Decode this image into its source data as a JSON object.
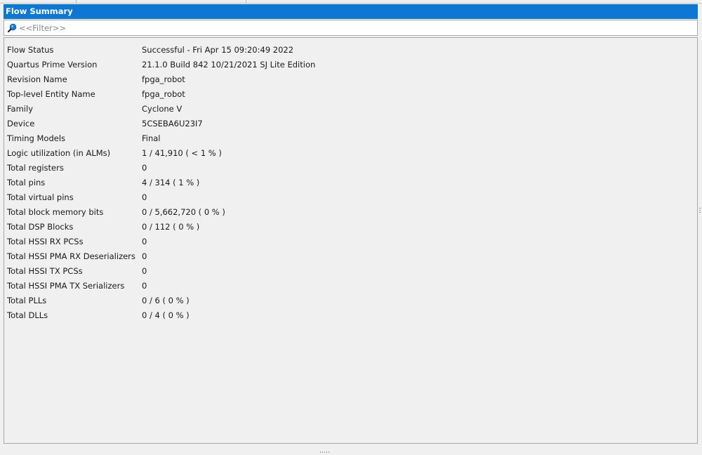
{
  "panel": {
    "title": "Flow Summary",
    "filter": {
      "placeholder": "<<Filter>>",
      "value": "",
      "icon": "search-icon"
    }
  },
  "summary": [
    {
      "label": "Flow Status",
      "value": "Successful - Fri Apr 15 09:20:49 2022"
    },
    {
      "label": "Quartus Prime Version",
      "value": "21.1.0 Build 842 10/21/2021 SJ Lite Edition"
    },
    {
      "label": "Revision Name",
      "value": "fpga_robot"
    },
    {
      "label": "Top-level Entity Name",
      "value": "fpga_robot"
    },
    {
      "label": "Family",
      "value": "Cyclone V"
    },
    {
      "label": "Device",
      "value": "5CSEBA6U23I7"
    },
    {
      "label": "Timing Models",
      "value": "Final"
    },
    {
      "label": "Logic utilization (in ALMs)",
      "value": "1 / 41,910 ( < 1 % )"
    },
    {
      "label": "Total registers",
      "value": "0"
    },
    {
      "label": "Total pins",
      "value": "4 / 314 ( 1 % )"
    },
    {
      "label": "Total virtual pins",
      "value": "0"
    },
    {
      "label": "Total block memory bits",
      "value": "0 / 5,662,720 ( 0 % )"
    },
    {
      "label": "Total DSP Blocks",
      "value": "0 / 112 ( 0 % )"
    },
    {
      "label": "Total HSSI RX PCSs",
      "value": "0"
    },
    {
      "label": "Total HSSI PMA RX Deserializers",
      "value": "0"
    },
    {
      "label": "Total HSSI TX PCSs",
      "value": "0"
    },
    {
      "label": "Total HSSI PMA TX Serializers",
      "value": "0"
    },
    {
      "label": "Total PLLs",
      "value": "0 / 6 ( 0 % )"
    },
    {
      "label": "Total DLLs",
      "value": "0 / 4 ( 0 % )"
    }
  ],
  "colors": {
    "title_bar": "#0c78d4",
    "title_text": "#ffffff",
    "background": "#f0f0f0",
    "border": "#a8a8a8",
    "search_icon": "#1a7fd4"
  }
}
